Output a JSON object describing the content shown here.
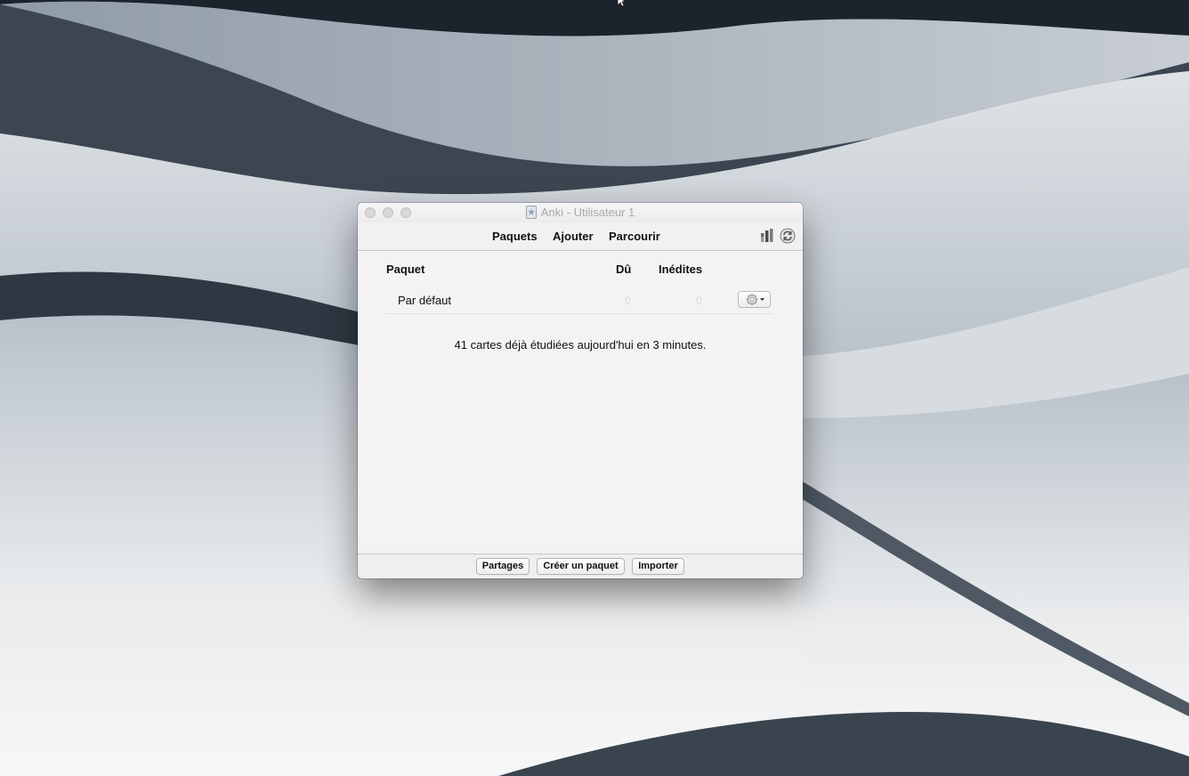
{
  "window": {
    "title": "Anki - Utilisateur 1"
  },
  "toolbar": {
    "decks_label": "Paquets",
    "add_label": "Ajouter",
    "browse_label": "Parcourir",
    "stats_icon": "stats-icon",
    "sync_icon": "sync-icon"
  },
  "deck_list": {
    "headers": {
      "deck": "Paquet",
      "due": "Dû",
      "new": "Inédites"
    },
    "rows": [
      {
        "name": "Par défaut",
        "due": "0",
        "new": "0",
        "options_icon": "gear-icon"
      }
    ]
  },
  "studied_today": "41 cartes déjà étudiées aujourd'hui en 3 minutes.",
  "bottom_bar": {
    "shared_label": "Partages",
    "create_deck_label": "Créer un paquet",
    "import_label": "Importer"
  }
}
